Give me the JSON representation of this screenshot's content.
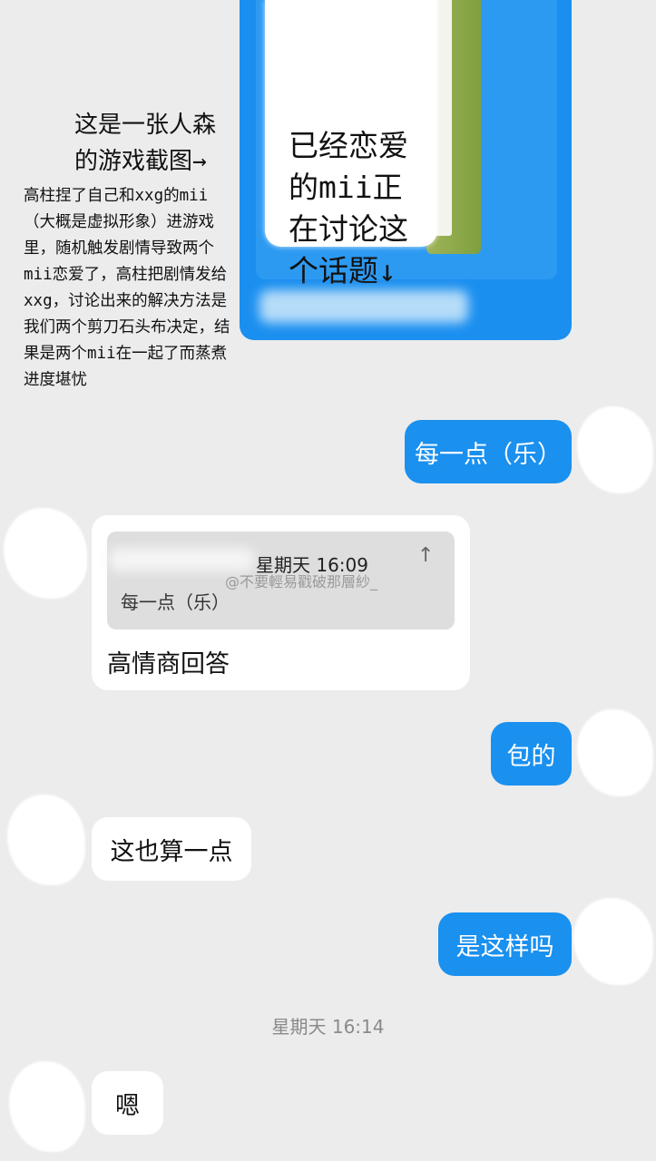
{
  "image_note": "已经恋爱\n的mii正\n在讨论这\n个话题↓",
  "annotation": {
    "title": "这是一张人森\n的游戏截图→",
    "body": "高柱捏了自己和xxg的mii（大概是虚拟形象）进游戏里，随机触发剧情导致两个mii恋爱了，高柱把剧情发给xxg，讨论出来的解决方法是我们两个剪刀石头布决定，结果是两个mii在一起了而蒸煮进度堪忧"
  },
  "messages": {
    "m1": "每一点（乐）",
    "reply_quote": {
      "time": "星期天 16:09",
      "text": "每一点（乐）",
      "arrow": "↑"
    },
    "m2": "高情商回答",
    "m3": "包的",
    "m4": "这也算一点",
    "m5": "是这样吗",
    "m6": "嗯"
  },
  "timestamp": "星期天 16:14",
  "watermark": "@不要輕易戳破那層紗_",
  "colors": {
    "outgoing_bubble": "#1a90ef",
    "incoming_bubble": "#ffffff",
    "background": "#ececec"
  }
}
